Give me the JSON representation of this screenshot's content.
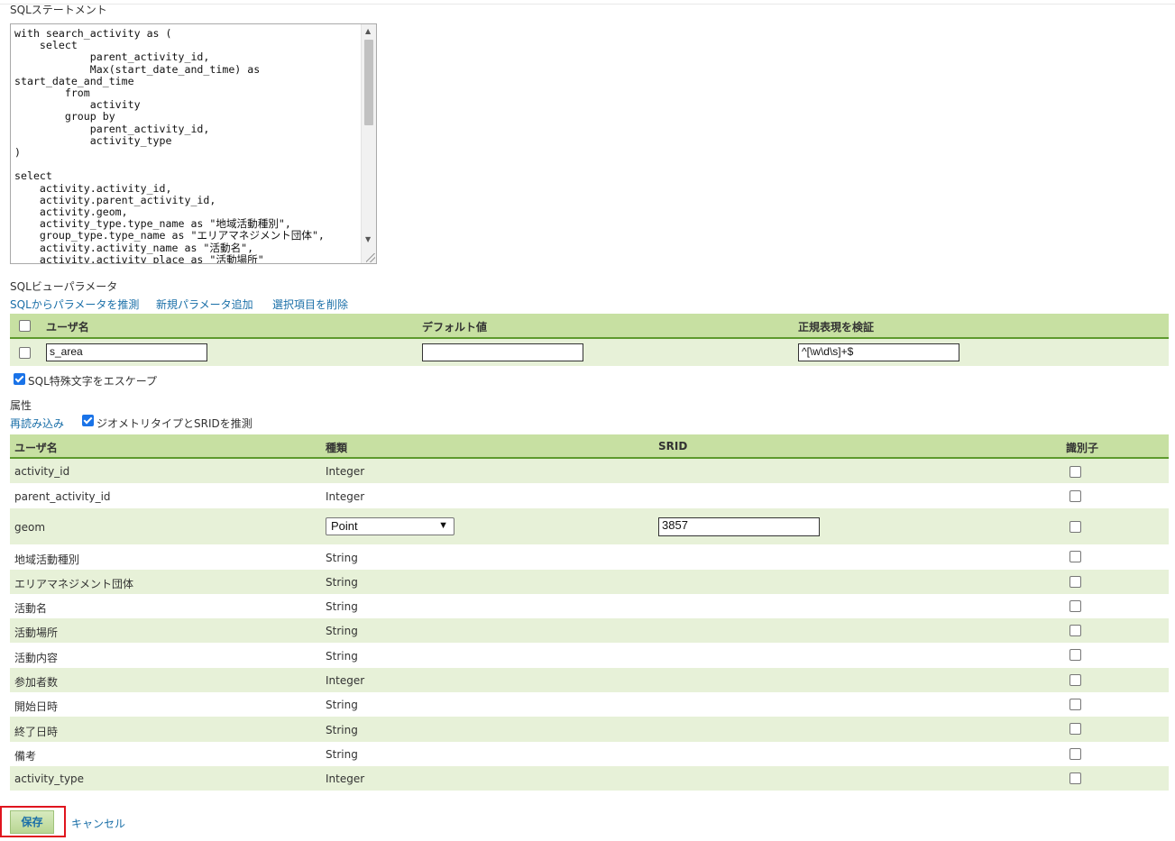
{
  "sql_section": {
    "label": "SQLステートメント",
    "statement": "with search_activity as (\n    select\n            parent_activity_id,\n            Max(start_date_and_time) as\nstart_date_and_time\n        from\n            activity\n        group by\n            parent_activity_id,\n            activity_type\n)\n\nselect\n    activity.activity_id,\n    activity.parent_activity_id,\n    activity.geom,\n    activity_type.type_name as \"地域活動種別\",\n    group_type.type_name as \"エリアマネジメント団体\",\n    activity.activity_name as \"活動名\",\n    activity.activity_place as \"活動場所\""
  },
  "params_section": {
    "label": "SQLビューパラメータ",
    "links": [
      "SQLからパラメータを推測",
      "新規パラメータ追加",
      "選択項目を削除"
    ],
    "headers": [
      "ユーザ名",
      "デフォルト値",
      "正規表現を検証"
    ],
    "rows": [
      {
        "name": "s_area",
        "default": "",
        "regex": "^[\\w\\d\\s]+$",
        "checked": false
      }
    ],
    "escape_label": "SQL特殊文字をエスケープ",
    "escape_checked": true
  },
  "attrs_section": {
    "label": "属性",
    "reload_link": "再読み込み",
    "guess_label": "ジオメトリタイプとSRIDを推測",
    "guess_checked": true,
    "headers": [
      "ユーザ名",
      "種類",
      "SRID",
      "識別子"
    ],
    "rows": [
      {
        "name": "activity_id",
        "type": "Integer"
      },
      {
        "name": "parent_activity_id",
        "type": "Integer"
      },
      {
        "name": "geom",
        "type": "Point",
        "srid": "3857"
      },
      {
        "name": "地域活動種別",
        "type": "String"
      },
      {
        "name": "エリアマネジメント団体",
        "type": "String"
      },
      {
        "name": "活動名",
        "type": "String"
      },
      {
        "name": "活動場所",
        "type": "String"
      },
      {
        "name": "活動内容",
        "type": "String"
      },
      {
        "name": "参加者数",
        "type": "Integer"
      },
      {
        "name": "開始日時",
        "type": "String"
      },
      {
        "name": "終了日時",
        "type": "String"
      },
      {
        "name": "備考",
        "type": "String"
      },
      {
        "name": "activity_type",
        "type": "Integer"
      }
    ]
  },
  "actions": {
    "save_label": "保存",
    "cancel_label": "キャンセル"
  },
  "colors": {
    "header_bg": "#c7e0a2",
    "row_alt_bg": "#e7f1d8",
    "link": "#1a6fa8",
    "highlight_frame": "#e0141e"
  }
}
